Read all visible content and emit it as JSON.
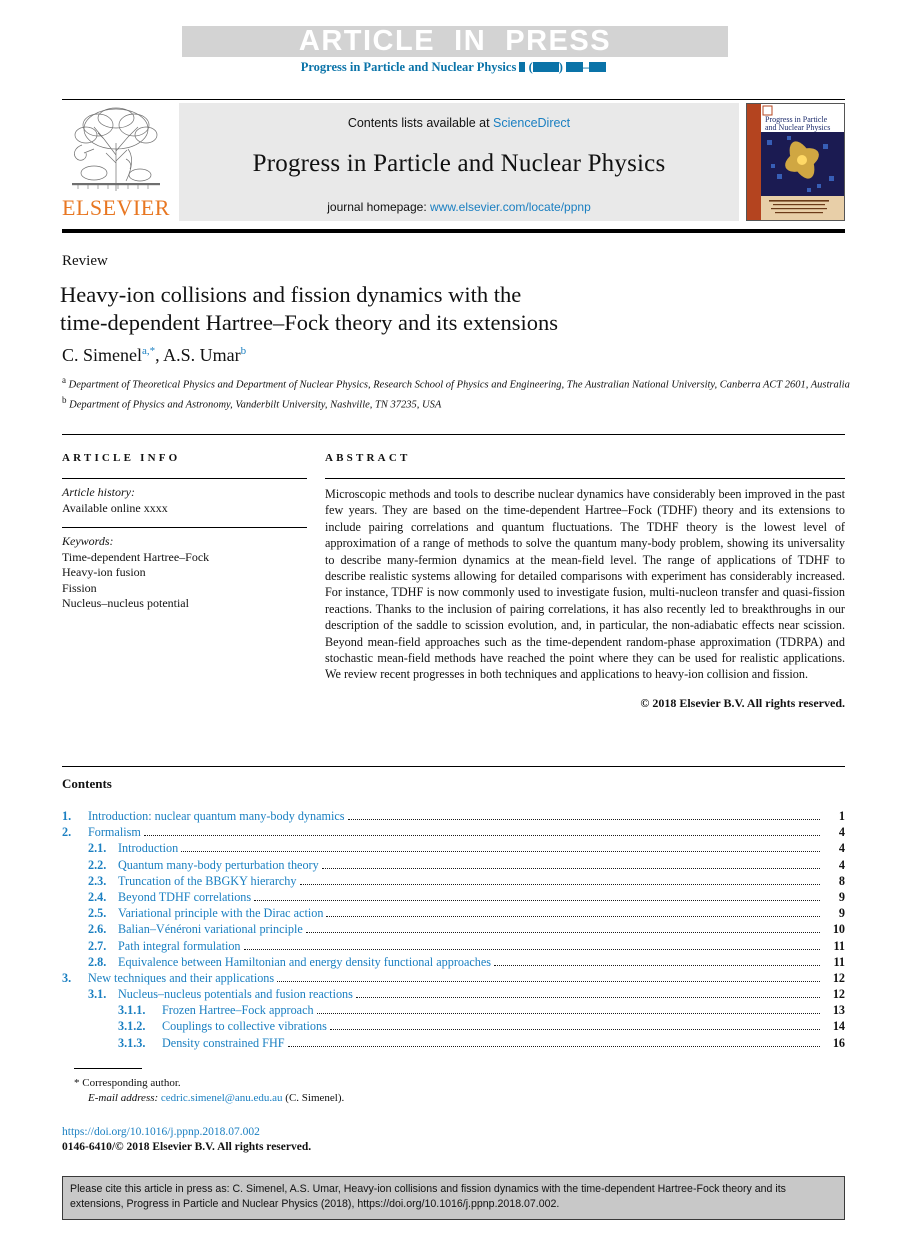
{
  "banner": {
    "article_in_press": "ARTICLE  IN  PRESS",
    "journal_ref_prefix": "Progress in Particle and Nuclear Physics"
  },
  "masthead": {
    "contents_prefix": "Contents lists available at ",
    "sciencedirect": "ScienceDirect",
    "journal_title": "Progress in Particle and Nuclear Physics",
    "homepage_prefix": "journal homepage: ",
    "homepage_url": "www.elsevier.com/locate/ppnp",
    "publisher": "ELSEVIER",
    "cover_title_line1": "Progress in Particle",
    "cover_title_line2": "and Nuclear Physics"
  },
  "article": {
    "doctype": "Review",
    "title_line1": "Heavy-ion collisions and fission dynamics with the",
    "title_line2": "time-dependent Hartree–Fock theory and its extensions",
    "author1": "C. Simenel",
    "author1_marks": "a,*",
    "author2": "A.S. Umar",
    "author2_marks": "b",
    "affiliation_a_sup": "a",
    "affiliation_a": "Department of Theoretical Physics and Department of Nuclear Physics, Research School of Physics and Engineering, The Australian National University, Canberra ACT 2601, Australia",
    "affiliation_b_sup": "b",
    "affiliation_b": "Department of Physics and Astronomy, Vanderbilt University, Nashville, TN 37235, USA"
  },
  "article_info": {
    "heading": "ARTICLE INFO",
    "history_label": "Article history:",
    "history_value": "Available online xxxx",
    "keywords_label": "Keywords:",
    "keywords": [
      "Time-dependent Hartree–Fock",
      "Heavy-ion fusion",
      "Fission",
      "Nucleus–nucleus potential"
    ]
  },
  "abstract": {
    "heading": "ABSTRACT",
    "text": "Microscopic methods and tools to describe nuclear dynamics have considerably been improved in the past few years. They are based on the time-dependent Hartree–Fock (TDHF) theory and its extensions to include pairing correlations and quantum fluctuations. The TDHF theory is the lowest level of approximation of a range of methods to solve the quantum many-body problem, showing its universality to describe many-fermion dynamics at the mean-field level. The range of applications of TDHF to describe realistic systems allowing for detailed comparisons with experiment has considerably increased. For instance, TDHF is now commonly used to investigate fusion, multi-nucleon transfer and quasi-fission reactions. Thanks to the inclusion of pairing correlations, it has also recently led to breakthroughs in our description of the saddle to scission evolution, and, in particular, the non-adiabatic effects near scission. Beyond mean-field approaches such as the time-dependent random-phase approximation (TDRPA) and stochastic mean-field methods have reached the point where they can be used for realistic applications. We review recent progresses in both techniques and applications to heavy-ion collision and fission.",
    "copyright": "© 2018 Elsevier B.V. All rights reserved."
  },
  "contents": {
    "heading": "Contents",
    "entries": [
      {
        "level": 1,
        "num": "1.",
        "label": "Introduction: nuclear quantum many-body dynamics",
        "page": "1"
      },
      {
        "level": 1,
        "num": "2.",
        "label": "Formalism",
        "page": "4"
      },
      {
        "level": 2,
        "num": "2.1.",
        "label": "Introduction",
        "page": "4"
      },
      {
        "level": 2,
        "num": "2.2.",
        "label": "Quantum many-body perturbation theory",
        "page": "4"
      },
      {
        "level": 2,
        "num": "2.3.",
        "label": "Truncation of the BBGKY hierarchy",
        "page": "8"
      },
      {
        "level": 2,
        "num": "2.4.",
        "label": "Beyond TDHF correlations",
        "page": "9"
      },
      {
        "level": 2,
        "num": "2.5.",
        "label": "Variational principle with the Dirac action",
        "page": "9"
      },
      {
        "level": 2,
        "num": "2.6.",
        "label": "Balian–Vénéroni variational principle",
        "page": "10"
      },
      {
        "level": 2,
        "num": "2.7.",
        "label": "Path integral formulation",
        "page": "11"
      },
      {
        "level": 2,
        "num": "2.8.",
        "label": "Equivalence between Hamiltonian and energy density functional approaches",
        "page": "11"
      },
      {
        "level": 1,
        "num": "3.",
        "label": "New techniques and their applications",
        "page": "12"
      },
      {
        "level": 2,
        "num": "3.1.",
        "label": "Nucleus–nucleus potentials and fusion reactions",
        "page": "12"
      },
      {
        "level": 3,
        "num": "3.1.1.",
        "label": "Frozen Hartree–Fock approach",
        "page": "13"
      },
      {
        "level": 3,
        "num": "3.1.2.",
        "label": "Couplings to collective vibrations",
        "page": "14"
      },
      {
        "level": 3,
        "num": "3.1.3.",
        "label": "Density constrained FHF",
        "page": "16"
      }
    ]
  },
  "footnote": {
    "star": "*",
    "corresponding": "Corresponding author.",
    "email_label": "E-mail address:",
    "email": "cedric.simenel@anu.edu.au",
    "email_owner": "(C. Simenel).",
    "doi": "https://doi.org/10.1016/j.ppnp.2018.07.002",
    "issn_line": "0146-6410/© 2018 Elsevier B.V. All rights reserved."
  },
  "citation_box": {
    "text": "Please cite this article in press as: C. Simenel, A.S. Umar, Heavy-ion collisions and fission dynamics with the time-dependent Hartree-Fock theory and its extensions, Progress in Particle and Nuclear Physics (2018), https://doi.org/10.1016/j.ppnp.2018.07.002."
  },
  "colors": {
    "link": "#1a7fc1",
    "journal_ref": "#0a73a8",
    "elsevier_orange": "#e87722",
    "band_gray": "#d3d3d3",
    "masthead_gray": "#e9e9e9",
    "cite_box_gray": "#c8c8c8"
  }
}
